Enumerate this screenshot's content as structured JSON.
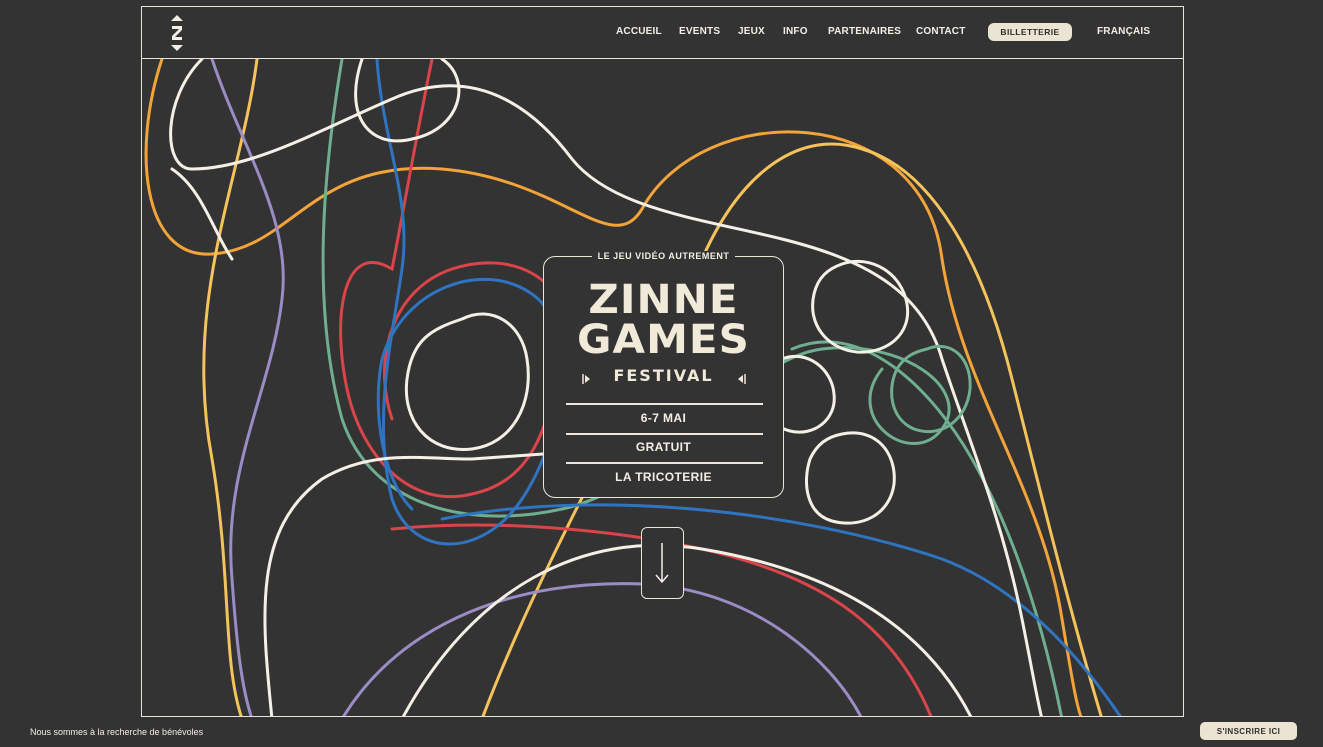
{
  "nav": {
    "items": [
      {
        "label": "ACCUEIL"
      },
      {
        "label": "EVENTS"
      },
      {
        "label": "JEUX"
      },
      {
        "label": "INFO"
      },
      {
        "label": "PARTENAIRES"
      },
      {
        "label": "CONTACT"
      }
    ],
    "ticket_label": "BILLETTERIE",
    "language_label": "FRANÇAIS"
  },
  "hero": {
    "tagline": "LE JEU VIDÉO AUTREMENT",
    "title_line1": "ZINNE",
    "title_line2": "GAMES",
    "title_line3": "FESTIVAL",
    "dates": "6-7 MAI",
    "price": "GRATUIT",
    "venue": "LA TRICOTERIE"
  },
  "footer": {
    "message": "Nous sommes à la recherche de bénévoles",
    "signup_label": "S'INSCRIRE ICI"
  },
  "colors": {
    "background": "#333333",
    "cream": "#ece4d2",
    "line_white": "#f4f0e6",
    "line_orange": "#f2a33a",
    "line_yellow": "#f5c35b",
    "line_green": "#6fae8f",
    "line_blue": "#2f74c0",
    "line_red": "#d9454a",
    "line_purple": "#9a8cc4"
  }
}
